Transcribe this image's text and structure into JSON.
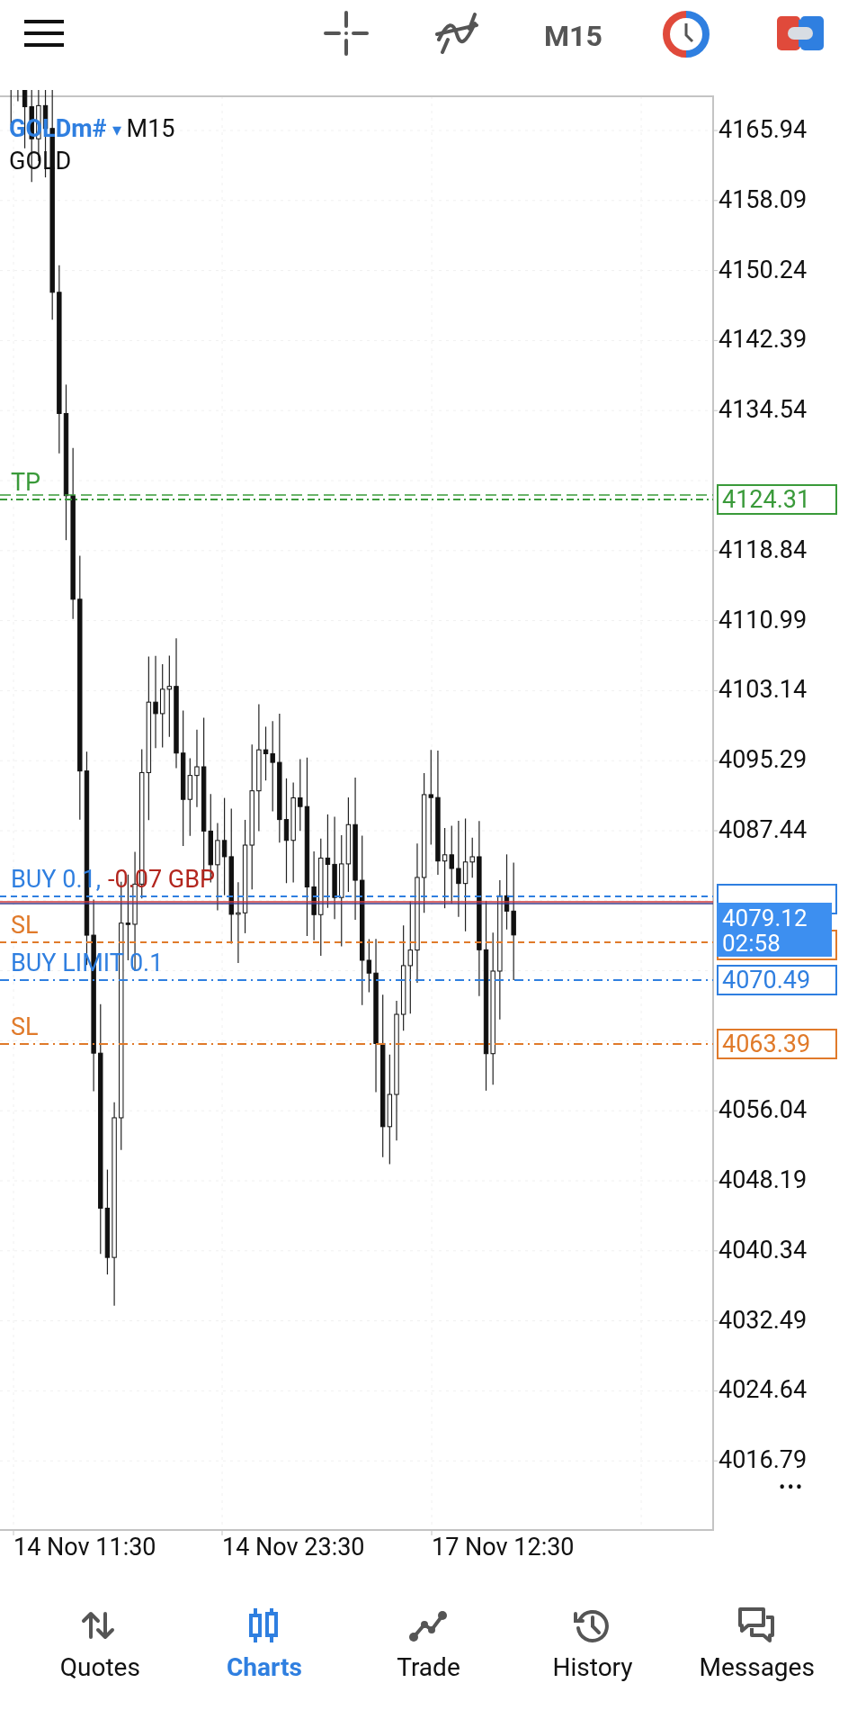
{
  "toolbar": {
    "timeframe": "M15"
  },
  "chart": {
    "symbol": "GOLDm#",
    "dropdown": "▾",
    "timeframe": "M15",
    "description": "GOLD",
    "price_axis": [
      "4165.94",
      "4158.09",
      "4150.24",
      "4142.39",
      "4134.54",
      "4118.84",
      "4110.99",
      "4103.14",
      "4095.29",
      "4087.44",
      "4056.04",
      "4048.19",
      "4040.34",
      "4032.49",
      "4024.64",
      "4016.79"
    ],
    "time_axis": [
      "14 Nov 11:30",
      "14 Nov 23:30",
      "17 Nov 12:30"
    ],
    "levels": [
      {
        "kind": "tp",
        "label": "TP",
        "price": "4124.31"
      },
      {
        "kind": "position",
        "label": "BUY 0.1,",
        "profit": "-0.07 GBP"
      },
      {
        "kind": "sl",
        "label": "SL"
      },
      {
        "kind": "pending",
        "label": "BUY LIMIT 0.1",
        "price": "4070.49"
      },
      {
        "kind": "sl",
        "label": "SL",
        "price": "4063.39"
      }
    ],
    "current_price": {
      "price": "4079.12",
      "countdown": "02:58"
    },
    "more": "•••"
  },
  "nav": [
    {
      "label": "Quotes",
      "selected": false
    },
    {
      "label": "Charts",
      "selected": true
    },
    {
      "label": "Trade",
      "selected": false
    },
    {
      "label": "History",
      "selected": false
    },
    {
      "label": "Messages",
      "selected": false
    }
  ]
}
